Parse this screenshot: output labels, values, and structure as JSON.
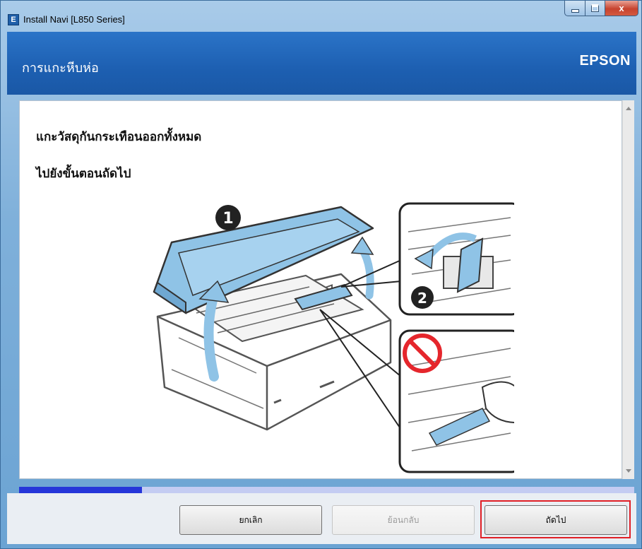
{
  "window": {
    "title": "Install Navi [L850 Series]",
    "icon_letter": "E",
    "close_glyph": "x"
  },
  "header": {
    "title": "การแกะหีบห่อ",
    "brand": "EPSON"
  },
  "content": {
    "instruction_1": "แกะวัสดุกันกระเทือนออกทั้งหมด",
    "instruction_2": "ไปยังขั้นตอนถัดไป",
    "illustration": {
      "step_1_marker": "1",
      "step_2_marker": "2"
    }
  },
  "progress": {
    "fraction": 0.2
  },
  "footer": {
    "cancel_label": "ยกเลิก",
    "back_label": "ย้อนกลับ",
    "next_label": "ถัดไป"
  },
  "colors": {
    "header_blue": "#1d5fb1",
    "progress_fill": "#2636d9",
    "progress_track": "#c4ccf2",
    "highlight_red": "#e01f26",
    "printer_blue": "#8fc3e6"
  }
}
